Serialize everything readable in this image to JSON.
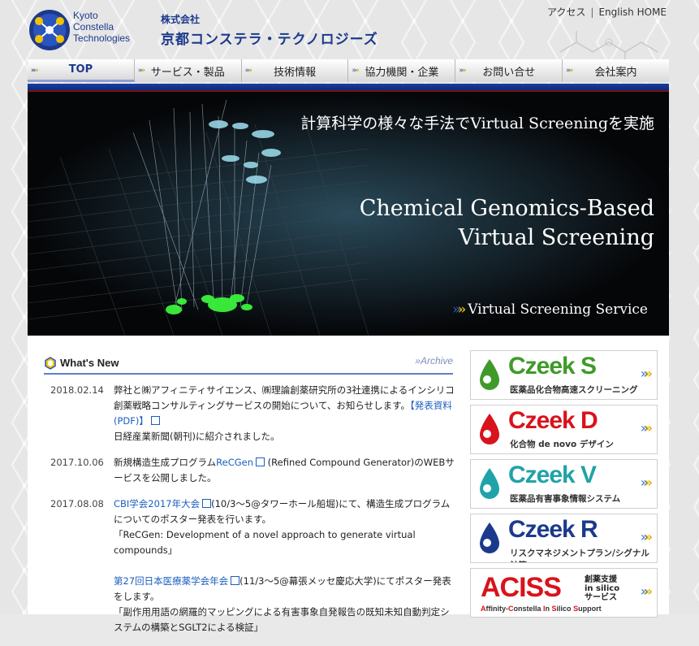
{
  "header": {
    "logo_lines": [
      "Kyoto",
      "Constella",
      "Technologies"
    ],
    "company_small": "株式会社",
    "company_name": "京都コンステラ・テクノロジーズ",
    "links": {
      "access": "アクセス",
      "separator": "|",
      "english": "English HOME"
    }
  },
  "nav": {
    "items": [
      {
        "label": "TOP"
      },
      {
        "label": "サービス・製品"
      },
      {
        "label": "技術情報"
      },
      {
        "label": "協力機関・企業"
      },
      {
        "label": "お問い合せ"
      },
      {
        "label": "会社案内"
      }
    ]
  },
  "hero": {
    "tagline_jp": "計算科学の様々な手法でVirtual Screeningを実施",
    "title_line1": "Chemical Genomics-Based",
    "title_line2": "Virtual Screening",
    "service_link": "Virtual Screening Service"
  },
  "whats_new": {
    "title": "What's New",
    "archive": "Archive",
    "items": [
      {
        "date": "2018.02.14",
        "text1": "弊社と㈱アフィニティサイエンス、㈱理論創薬研究所の3社連携によるインシリコ創薬戦略コンサルティングサービスの開始について、お知らせします。",
        "link": "【発表資料(PDF)】",
        "text2": "日経産業新聞(朝刊)に紹介されました。"
      },
      {
        "date": "2017.10.06",
        "text1": "新規構造生成プログラム",
        "link": "ReCGen",
        "text2": "(Refined Compound Generator)のWEBサービスを公開しました。"
      },
      {
        "date": "2017.08.08",
        "link1": "CBI学会2017年大会",
        "text1": "(10/3～5@タワーホール船堀)にて、構造生成プログラムについてのポスター発表を行います。",
        "quote1": "「ReCGen: Development of a novel approach to generate virtual compounds」",
        "link2": "第27回日本医療薬学会年会",
        "text2": "(11/3～5@幕張メッセ慶応大学)にてポスター発表をします。",
        "quote2": "「副作用用語の網羅的マッピングによる有害事象自発報告の既知未知自動判定システムの構築とSGLT2による検証」"
      }
    ]
  },
  "banners": [
    {
      "name": "Czeek S",
      "sub": "医薬品化合物高速スクリーニング",
      "color": "#3f9a2a",
      "icon": "drop-green-icon"
    },
    {
      "name": "Czeek D",
      "sub": "化合物 de novo デザイン",
      "color": "#d8131b",
      "icon": "drop-red-icon"
    },
    {
      "name": "Czeek V",
      "sub": "医薬品有害事象情報システム",
      "color": "#1fa3a8",
      "icon": "drop-teal-icon"
    },
    {
      "name": "Czeek R",
      "sub": "リスクマネジメントプラン/シグナル計算",
      "color": "#1c3a8c",
      "icon": "drop-blue-icon"
    }
  ],
  "aciss": {
    "name": "ACISS",
    "side": [
      "創薬支援",
      "in silico",
      "サービス"
    ],
    "sub_r1": "A",
    "sub1": "ffinity-",
    "sub_r2": "C",
    "sub2": "onstella ",
    "sub_r3": "I",
    "sub3": "n ",
    "sub_r4": "S",
    "sub4": "ilico ",
    "sub_r5": "S",
    "sub5": "upport"
  }
}
